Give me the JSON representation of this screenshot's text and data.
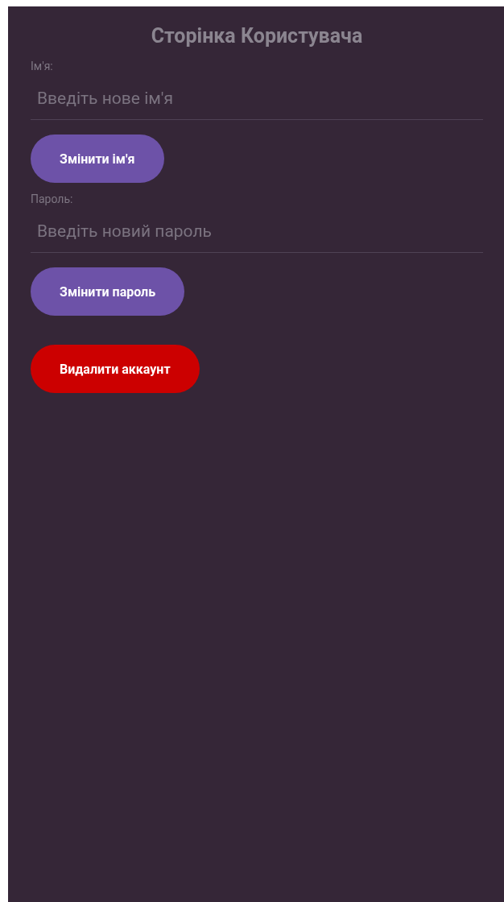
{
  "title": "Сторінка Користувача",
  "fields": [
    {
      "label": "Ім'я:",
      "placeholder": "Введіть нове ім'я",
      "button": {
        "label": "Змінити ім'я",
        "kind": "primary"
      }
    },
    {
      "label": "Пароль:",
      "placeholder": "Введіть новий пароль",
      "button": {
        "label": "Змінити пароль",
        "kind": "primary"
      }
    }
  ],
  "delete_button": {
    "label": "Видалити аккаунт",
    "kind": "danger"
  }
}
